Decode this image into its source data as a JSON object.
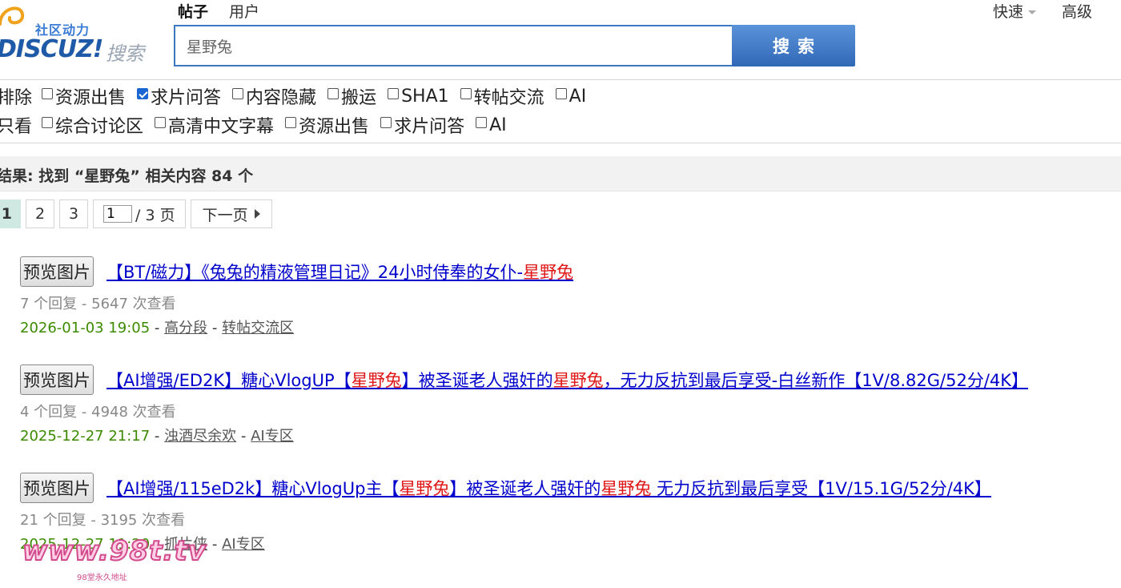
{
  "logo": {
    "tagline": "社区动力",
    "word": "DISCUZ!",
    "search_word": "搜索"
  },
  "scope_tabs": [
    {
      "label": "帖子",
      "active": true
    },
    {
      "label": "用户",
      "active": false
    }
  ],
  "quick_links": {
    "quick": "快速",
    "advanced": "高级"
  },
  "search": {
    "value": "星野兔",
    "button": "搜索"
  },
  "filters": {
    "row1_prefix": "排除",
    "row1": [
      {
        "label": "资源出售",
        "checked": false
      },
      {
        "label": "求片问答",
        "checked": true
      },
      {
        "label": "内容隐藏",
        "checked": false
      },
      {
        "label": "搬运",
        "checked": false
      },
      {
        "label": "SHA1",
        "checked": false
      },
      {
        "label": "转帖交流",
        "checked": false
      },
      {
        "label": "AI",
        "checked": false
      }
    ],
    "row2_prefix": "只看",
    "row2": [
      {
        "label": "综合讨论区",
        "checked": false
      },
      {
        "label": "高清中文字幕",
        "checked": false
      },
      {
        "label": "资源出售",
        "checked": false
      },
      {
        "label": "求片问答",
        "checked": false
      },
      {
        "label": "AI",
        "checked": false
      }
    ]
  },
  "results_header": {
    "prefix": "结果: 找到 “",
    "keyword": "星野兔",
    "suffix": "” 相关内容 84 个"
  },
  "pagination": {
    "current": "1",
    "pages": [
      "2",
      "3"
    ],
    "jump_value": "1",
    "total": "/ 3 页",
    "next": "下一页"
  },
  "results": [
    {
      "preview": "预览图片",
      "title_before": "【BT/磁力】《兔兔的精液管理日记》24小时侍奉的女仆-",
      "title_hl": "星野兔",
      "title_after": "",
      "title_hl2": "",
      "title_after2": "",
      "stats": "7 个回复 - 5647 次查看",
      "date": "2026-01-03 19:05",
      "author": "高分段",
      "forum": "转帖交流区"
    },
    {
      "preview": "预览图片",
      "title_before": "【AI增强/ED2K】糖心VlogUP【",
      "title_hl": "星野兔",
      "title_after": "】被圣诞老人强奸的",
      "title_hl2": "星野兔",
      "title_after2": "，无力反抗到最后享受-白丝新作【1V/8.82G/52分/4K】",
      "stats": "4 个回复 - 4948 次查看",
      "date": "2025-12-27 21:17",
      "author": "浊酒尽余欢",
      "forum": "AI专区"
    },
    {
      "preview": "预览图片",
      "title_before": "【AI增强/115eD2k】糖心VlogUp主【",
      "title_hl": "星野兔",
      "title_after": "】被圣诞老人强奸的",
      "title_hl2": "星野兔",
      "title_after2": " 无力反抗到最后享受【1V/15.1G/52分/4K】",
      "stats": "21 个回复 - 3195 次查看",
      "date": "2025-12-27 11:20",
      "author": "抓片侠",
      "forum": "AI专区"
    }
  ],
  "watermark": {
    "main": "www.98t.tv",
    "sub": "98堂永久地址"
  },
  "colors": {
    "link": "#0000cc",
    "highlight": "#e01515",
    "date": "#3b8a00",
    "search_border": "#3d78c4",
    "search_button": "#3068b8",
    "current_page": "#cfe8e1"
  }
}
